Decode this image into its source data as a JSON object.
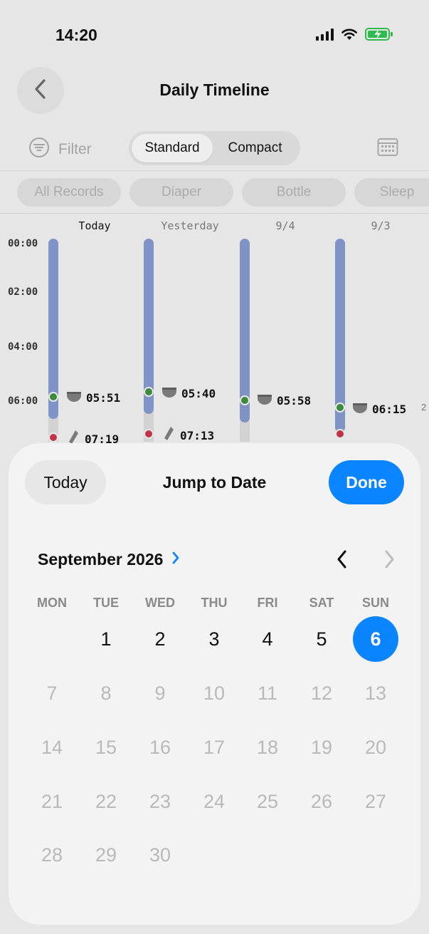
{
  "status_bar": {
    "time": "14:20"
  },
  "header": {
    "title": "Daily Timeline"
  },
  "filter": {
    "label": "Filter"
  },
  "view_mode": {
    "options": [
      "Standard",
      "Compact"
    ],
    "selected": "Standard"
  },
  "categories": [
    "All Records",
    "Diaper",
    "Bottle",
    "Sleep"
  ],
  "timeline": {
    "days": [
      {
        "label": "Today",
        "events": [
          {
            "icon": "diaper-icon",
            "time": "05:51"
          },
          {
            "icon": "bottle-icon",
            "time": "07:19"
          }
        ]
      },
      {
        "label": "Yesterday",
        "events": [
          {
            "icon": "diaper-icon",
            "time": "05:40"
          },
          {
            "icon": "bottle-icon",
            "time": "07:13"
          }
        ]
      },
      {
        "label": "9/4",
        "events": [
          {
            "icon": "diaper-icon",
            "time": "05:58"
          }
        ]
      },
      {
        "label": "9/3",
        "events": [
          {
            "icon": "diaper-icon",
            "time": "06:15"
          }
        ]
      }
    ],
    "hours": [
      "00:00",
      "02:00",
      "04:00",
      "06:00"
    ],
    "edge_value": "2"
  },
  "date_picker": {
    "today_label": "Today",
    "title": "Jump to Date",
    "done_label": "Done",
    "month_label": "September 2026",
    "weekdays": [
      "MON",
      "TUE",
      "WED",
      "THU",
      "FRI",
      "SAT",
      "SUN"
    ],
    "selected_day": "6",
    "available_days": [
      "1",
      "2",
      "3",
      "4",
      "5",
      "6"
    ],
    "weeks": [
      [
        "",
        "1",
        "2",
        "3",
        "4",
        "5",
        "6"
      ],
      [
        "7",
        "8",
        "9",
        "10",
        "11",
        "12",
        "13"
      ],
      [
        "14",
        "15",
        "16",
        "17",
        "18",
        "19",
        "20"
      ],
      [
        "21",
        "22",
        "23",
        "24",
        "25",
        "26",
        "27"
      ],
      [
        "28",
        "29",
        "30",
        "",
        "",
        "",
        ""
      ]
    ]
  },
  "colors": {
    "accent": "#0a84ff",
    "sleep_bar": "#8093c6",
    "diaper_dot": "#3c8a3a",
    "bottle_dot": "#c2334a"
  }
}
